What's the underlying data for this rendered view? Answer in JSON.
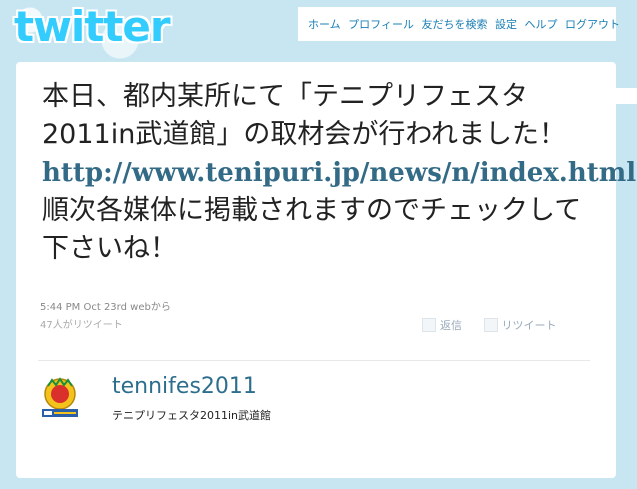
{
  "header": {
    "logo_text": "twitter",
    "nav": [
      "ホーム",
      "プロフィール",
      "友だちを検索",
      "設定",
      "ヘルプ",
      "ログアウト"
    ]
  },
  "tweet": {
    "text_before_link": "本日、都内某所にて「テニプリフェスタ2011in武道館」の取材会が行われました！",
    "link": "http://www.tenipuri.jp/news/n/index.html",
    "text_after_link": " 順次各媒体に掲載されますのでチェックして下さいね！",
    "timestamp": "5:44 PM Oct 23rd",
    "source": "webから",
    "retweet_count": "47人がリツイート"
  },
  "actions": {
    "reply": "返信",
    "retweet": "リツイート"
  },
  "author": {
    "username": "tennifes2011",
    "full_name": "テニプリフェスタ2011in武道館"
  },
  "colors": {
    "background": "#c7e6f1",
    "link": "#336b87",
    "logo": "#33ccff",
    "nav": "#1a7fb5"
  }
}
